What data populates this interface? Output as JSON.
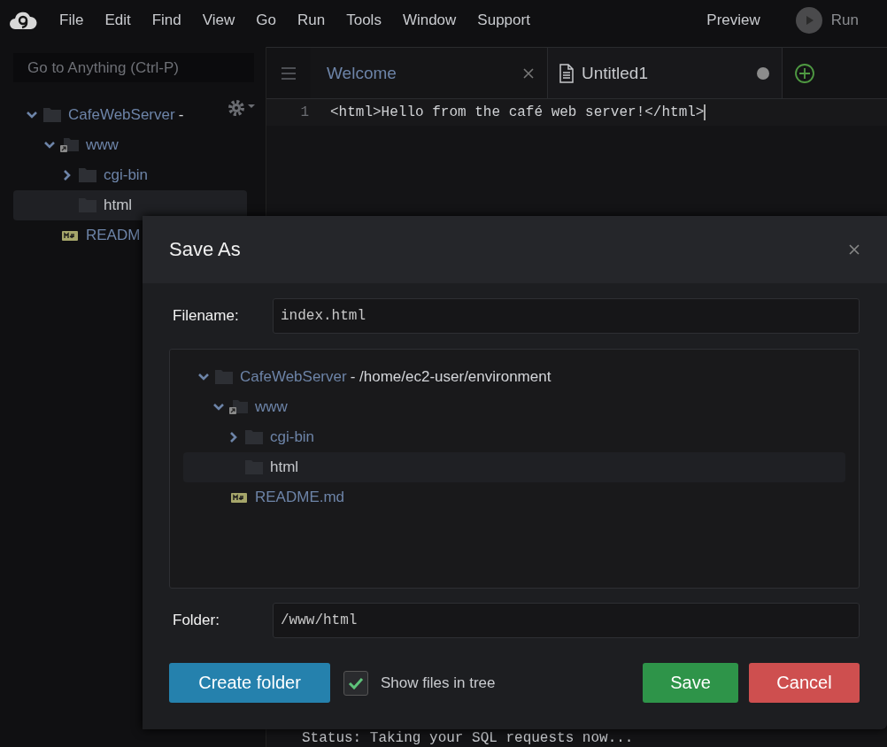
{
  "menu_bar": {
    "items": [
      "File",
      "Edit",
      "Find",
      "View",
      "Go",
      "Run",
      "Tools",
      "Window",
      "Support"
    ],
    "preview": "Preview",
    "run": "Run"
  },
  "sidebar": {
    "search": {
      "placeholder": "Go to Anything (Ctrl-P)"
    },
    "tree": [
      {
        "label": "CafeWebServer",
        "detail": "-",
        "kind": "folder",
        "expanded": true,
        "selected": false,
        "children": [
          {
            "label": "www",
            "kind": "linked_folder",
            "expanded": true,
            "selected": false,
            "children": [
              {
                "label": "cgi-bin",
                "kind": "folder",
                "expanded": false,
                "selected": false
              },
              {
                "label": "html",
                "kind": "folder",
                "selected": true
              }
            ]
          },
          {
            "label": "READM",
            "kind": "markdown",
            "selected": false
          }
        ]
      }
    ]
  },
  "tabs": [
    {
      "label": "Welcome",
      "selected": false,
      "modified": false
    },
    {
      "label": "Untitled1",
      "selected": true,
      "modified": true
    }
  ],
  "editor": {
    "lines": [
      {
        "number": "1",
        "text": "<html>Hello from the café web server!</html>"
      }
    ],
    "status_line": "Status: Taking your SQL requests now..."
  },
  "dialog": {
    "title": "Save As",
    "filename_label": "Filename:",
    "filename": "index.html",
    "tree": [
      {
        "label": "CafeWebServer",
        "detail": "- /home/ec2-user/environment",
        "kind": "folder",
        "expanded": true,
        "selected": false,
        "children": [
          {
            "label": "www",
            "kind": "linked_folder",
            "expanded": true,
            "selected": false,
            "children": [
              {
                "label": "cgi-bin",
                "kind": "folder",
                "expanded": false,
                "selected": false
              },
              {
                "label": "html",
                "kind": "folder",
                "selected": true
              }
            ]
          },
          {
            "label": "README.md",
            "kind": "markdown",
            "selected": false
          }
        ]
      }
    ],
    "folder_label": "Folder:",
    "folder": "/www/html",
    "create_folder": "Create folder",
    "show_files": {
      "label": "Show files in tree",
      "checked": true
    },
    "save": "Save",
    "cancel": "Cancel"
  }
}
